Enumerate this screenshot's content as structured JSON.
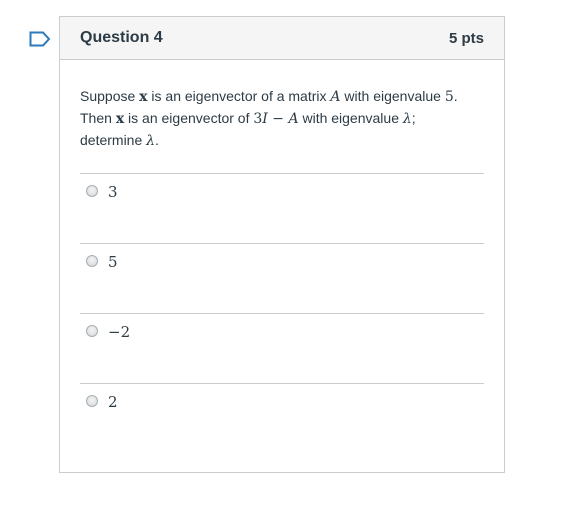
{
  "question": {
    "title": "Question 4",
    "points": "5 pts",
    "text_parts": [
      {
        "t": "Suppose "
      },
      {
        "t": "x",
        "style": "math-b"
      },
      {
        "t": " is an eigenvector of a matrix "
      },
      {
        "t": "A",
        "style": "math-i"
      },
      {
        "t": " with eigenvalue "
      },
      {
        "t": "5",
        "style": "math"
      },
      {
        "t": "."
      },
      {
        "br": true
      },
      {
        "t": "Then "
      },
      {
        "t": "x",
        "style": "math-b"
      },
      {
        "t": " is an eigenvector of "
      },
      {
        "t": "3",
        "style": "math"
      },
      {
        "t": "I",
        "style": "math-i"
      },
      {
        "t": " − ",
        "style": "math"
      },
      {
        "t": "A",
        "style": "math-i"
      },
      {
        "t": " with eigenvalue "
      },
      {
        "t": "λ",
        "style": "math-i"
      },
      {
        "t": ";"
      },
      {
        "br": true
      },
      {
        "t": "determine "
      },
      {
        "t": "λ",
        "style": "math-i"
      },
      {
        "t": "."
      }
    ],
    "answers": [
      "3",
      "5",
      "−2",
      "2"
    ]
  },
  "colors": {
    "border": "#c7cdd1",
    "header_bg": "#f5f5f5",
    "text": "#2d3b45",
    "flag": "#2b7abc"
  },
  "icons": {
    "flag": "bookmark-flag-icon"
  }
}
